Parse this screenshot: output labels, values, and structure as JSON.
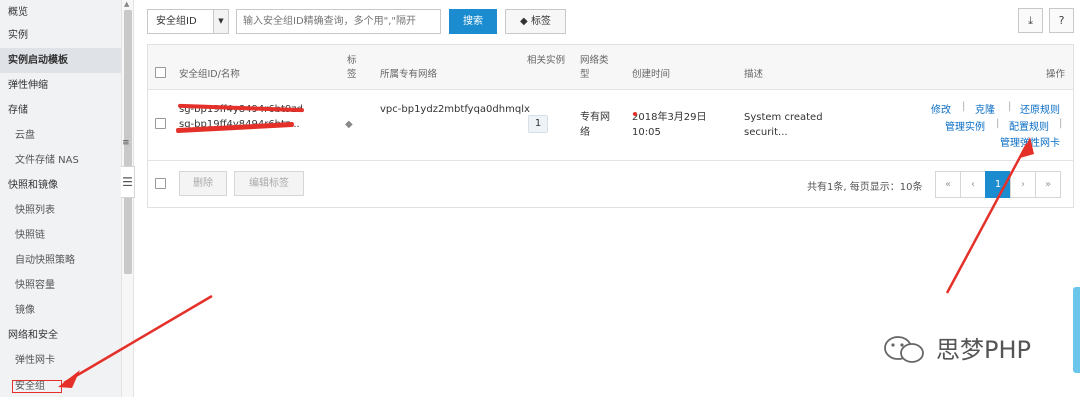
{
  "sidebar": {
    "items": [
      {
        "label": "概览",
        "kind": "top"
      },
      {
        "label": "实例",
        "kind": "top"
      },
      {
        "label": "实例启动模板",
        "kind": "top",
        "active": true
      },
      {
        "label": "弹性伸缩",
        "kind": "top"
      },
      {
        "label": "存储",
        "kind": "top"
      },
      {
        "label": "云盘",
        "kind": "sub"
      },
      {
        "label": "文件存储 NAS",
        "kind": "sub"
      },
      {
        "label": "快照和镜像",
        "kind": "top"
      },
      {
        "label": "快照列表",
        "kind": "sub"
      },
      {
        "label": "快照链",
        "kind": "sub"
      },
      {
        "label": "自动快照策略",
        "kind": "sub"
      },
      {
        "label": "快照容量",
        "kind": "sub"
      },
      {
        "label": "镜像",
        "kind": "sub"
      },
      {
        "label": "网络和安全",
        "kind": "top"
      },
      {
        "label": "弹性网卡",
        "kind": "sub"
      },
      {
        "label": "安全组",
        "kind": "sub",
        "boxed": true
      }
    ]
  },
  "toolbar": {
    "filter_select": "安全组ID",
    "search_placeholder": "输入安全组ID精确查询，多个用\",\"隔开",
    "search_button": "搜索",
    "tag_button": "标签",
    "export_icon": "export-icon",
    "help_label": "?"
  },
  "table": {
    "headers": {
      "id_name": "安全组ID/名称",
      "tag": "标签",
      "vpc": "所属专有网络",
      "instances": "相关实例",
      "net_type": "网络类型",
      "created": "创建时间",
      "desc": "描述",
      "ops": "操作"
    },
    "rows": [
      {
        "id": "sg-bp19ff4y8494r6bt9zd",
        "name": "sg-bp19ff4y8494r6btz...",
        "vpc": "vpc-bp1ydz2mbtfyqa0dhmqlx",
        "instances": "1",
        "net_type": "专有网络",
        "created_date": "2018年3月29日",
        "created_time": "10:05",
        "desc_line1": "System created",
        "desc_line2": "securit...",
        "ops": {
          "modify": "修改",
          "clone": "克隆",
          "restore": "还原规则",
          "manage_instances": "管理实例",
          "configure_rules": "配置规则",
          "manage_eni": "管理弹性网卡"
        }
      }
    ]
  },
  "footer": {
    "delete": "删除",
    "edit_tags": "编辑标签",
    "summary": "共有1条, 每页显示：10条",
    "pager": [
      "«",
      "‹",
      "1",
      "›",
      "»"
    ],
    "current_page": "1"
  },
  "watermark": "思梦PHP",
  "colors": {
    "accent": "#1b8ccf",
    "annotation": "#e5302a"
  }
}
